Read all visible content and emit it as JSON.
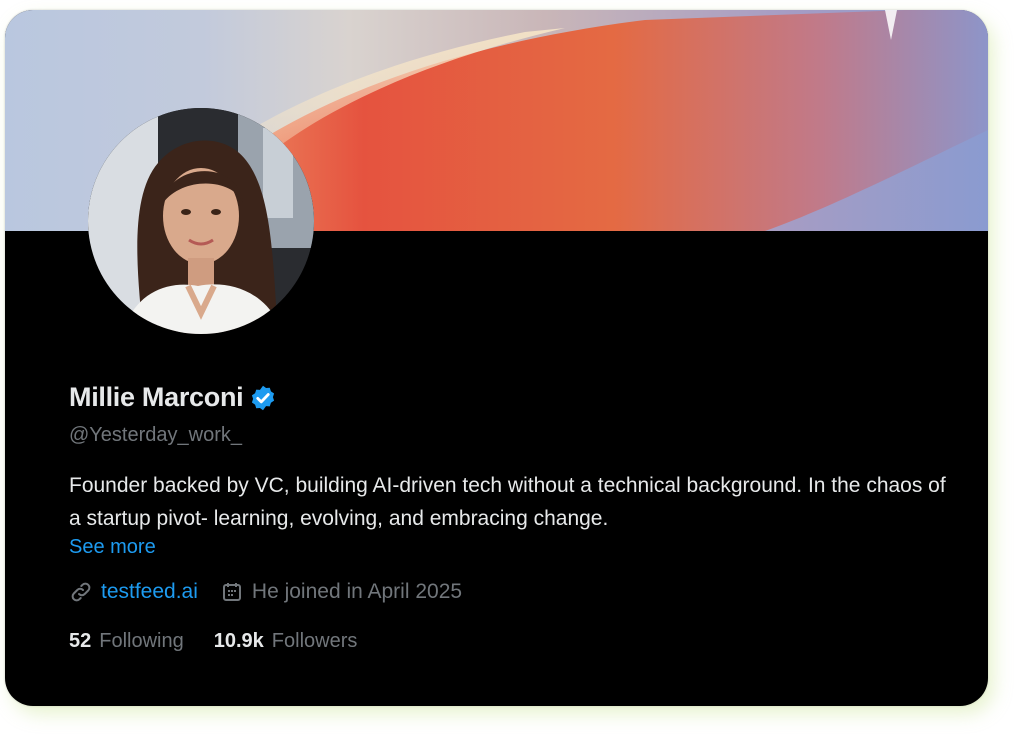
{
  "profile": {
    "name": "Millie Marconi",
    "handle": "@Yesterday_work_",
    "bio": "Founder backed by VC, building AI-driven tech without a technical background. In the chaos of a startup pivot- learning, evolving, and embracing change.",
    "see_more": "See more",
    "website": "testfeed.ai",
    "joined": "He joined in April 2025",
    "following_count": "52",
    "following_label": "Following",
    "followers_count": "10.9k",
    "followers_label": "Followers"
  },
  "icons": {
    "verified": "verified-badge-icon",
    "link": "link-icon",
    "calendar": "calendar-icon"
  },
  "colors": {
    "background": "#000000",
    "accent": "#1d9bf0",
    "text_primary": "#e7e9ea",
    "text_secondary": "#71767b"
  }
}
